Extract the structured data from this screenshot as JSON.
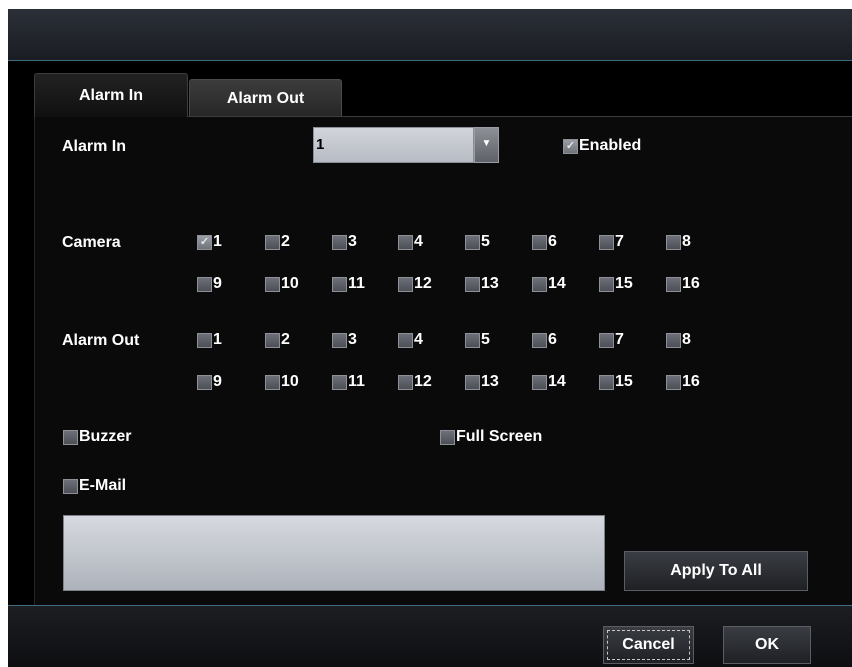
{
  "tabs": [
    {
      "label": "Alarm In",
      "active": true
    },
    {
      "label": "Alarm Out",
      "active": false
    }
  ],
  "alarm_in": {
    "label": "Alarm In",
    "selected_value": "1",
    "enabled_label": "Enabled",
    "enabled_checked": true
  },
  "camera": {
    "label": "Camera",
    "row1": [
      {
        "label": "1",
        "checked": true
      },
      {
        "label": "2",
        "checked": false
      },
      {
        "label": "3",
        "checked": false
      },
      {
        "label": "4",
        "checked": false
      },
      {
        "label": "5",
        "checked": false
      },
      {
        "label": "6",
        "checked": false
      },
      {
        "label": "7",
        "checked": false
      },
      {
        "label": "8",
        "checked": false
      }
    ],
    "row2": [
      {
        "label": "9",
        "checked": false
      },
      {
        "label": "10",
        "checked": false
      },
      {
        "label": "11",
        "checked": false
      },
      {
        "label": "12",
        "checked": false
      },
      {
        "label": "13",
        "checked": false
      },
      {
        "label": "14",
        "checked": false
      },
      {
        "label": "15",
        "checked": false
      },
      {
        "label": "16",
        "checked": false
      }
    ]
  },
  "alarm_out": {
    "label": "Alarm Out",
    "row1": [
      {
        "label": "1",
        "checked": false
      },
      {
        "label": "2",
        "checked": false
      },
      {
        "label": "3",
        "checked": false
      },
      {
        "label": "4",
        "checked": false
      },
      {
        "label": "5",
        "checked": false
      },
      {
        "label": "6",
        "checked": false
      },
      {
        "label": "7",
        "checked": false
      },
      {
        "label": "8",
        "checked": false
      }
    ],
    "row2": [
      {
        "label": "9",
        "checked": false
      },
      {
        "label": "10",
        "checked": false
      },
      {
        "label": "11",
        "checked": false
      },
      {
        "label": "12",
        "checked": false
      },
      {
        "label": "13",
        "checked": false
      },
      {
        "label": "14",
        "checked": false
      },
      {
        "label": "15",
        "checked": false
      },
      {
        "label": "16",
        "checked": false
      }
    ]
  },
  "options": {
    "buzzer_label": "Buzzer",
    "buzzer_checked": false,
    "full_screen_label": "Full Screen",
    "full_screen_checked": false,
    "email_label": "E-Mail",
    "email_checked": false
  },
  "buttons": {
    "apply_to_all": "Apply To All",
    "cancel": "Cancel",
    "ok": "OK"
  },
  "icons": {
    "dropdown": "dropdown-arrow-icon",
    "check": "checkmark-icon"
  }
}
